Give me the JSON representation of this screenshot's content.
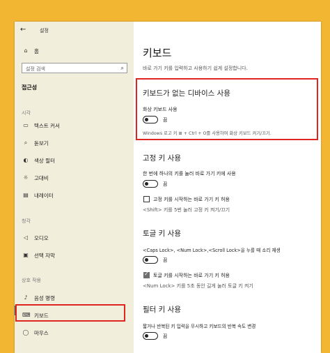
{
  "window": {
    "back_glyph": "←",
    "title": "설정"
  },
  "sidebar": {
    "home": {
      "icon": "home-icon",
      "label": "홈"
    },
    "search": {
      "placeholder": "설정 검색",
      "icon": "search-icon"
    },
    "category": "접근성",
    "sections": [
      {
        "title": "시각",
        "items": [
          {
            "icon": "display-icon",
            "glyph": "▭",
            "label": "텍스트 커서"
          },
          {
            "icon": "magnifier-icon",
            "glyph": "⌕",
            "label": "돋보기"
          },
          {
            "icon": "color-filter-icon",
            "glyph": "◐",
            "label": "색상 필터"
          },
          {
            "icon": "high-contrast-icon",
            "glyph": "☼",
            "label": "고대비"
          },
          {
            "icon": "narrator-icon",
            "glyph": "▤",
            "label": "내레이터"
          }
        ]
      },
      {
        "title": "청각",
        "items": [
          {
            "icon": "speaker-icon",
            "glyph": "◁",
            "label": "오디오"
          },
          {
            "icon": "caption-icon",
            "glyph": "▣",
            "label": "선택 자막"
          }
        ]
      },
      {
        "title": "상호 작용",
        "items": [
          {
            "icon": "microphone-icon",
            "glyph": "♪",
            "label": "음성 명령"
          },
          {
            "icon": "keyboard-icon",
            "glyph": "⌨",
            "label": "키보드"
          },
          {
            "icon": "mouse-icon",
            "glyph": "◯",
            "label": "마우스"
          }
        ]
      }
    ]
  },
  "main": {
    "title": "키보드",
    "subtitle": "바로 가기 키를 입력하고 사용하기 쉽게 설정합니다.",
    "osk": {
      "heading": "키보드가 없는 디바이스 사용",
      "toggle_label": "화상 키보드 사용",
      "toggle_state": "끔",
      "hint": "Windows 로고 키 ⊞ + Ctrl + O를 사용하여 화상 키보드 켜기/끄기."
    },
    "sticky": {
      "heading": "고정 키 사용",
      "desc": "한 번에 하나의 키를 눌러 바로 가기 키에 사용",
      "toggle_state": "끔",
      "checkbox_label": "고정 키를 시작하는 바로 가기 키 허용",
      "checkbox_checked": false,
      "hint": "<Shift> 키를 5번 눌러 고정 키 켜기/끄기"
    },
    "toggle_keys": {
      "heading": "토글 키 사용",
      "desc": "<Caps Lock>, <Num Lock>,<Scroll Lock>을 누를 때 소리 재생",
      "toggle_state": "끔",
      "checkbox_label": "토글 키를 시작하는 바로 가기 키 허용",
      "checkbox_checked": true,
      "hint": "<Num Lock> 키를 5초 동안 길게 눌러 토글 키 켜기"
    },
    "filter": {
      "heading": "필터 키 사용",
      "desc": "짧거나 반복된 키 입력을 무시하고 키보드의 반복 속도 변경",
      "toggle_state": "끔"
    }
  },
  "watermark": "니",
  "colors": {
    "highlight_box": "#e0241f",
    "sidebar_bg": "#f2eedc",
    "page_bg": "#f2b632"
  }
}
